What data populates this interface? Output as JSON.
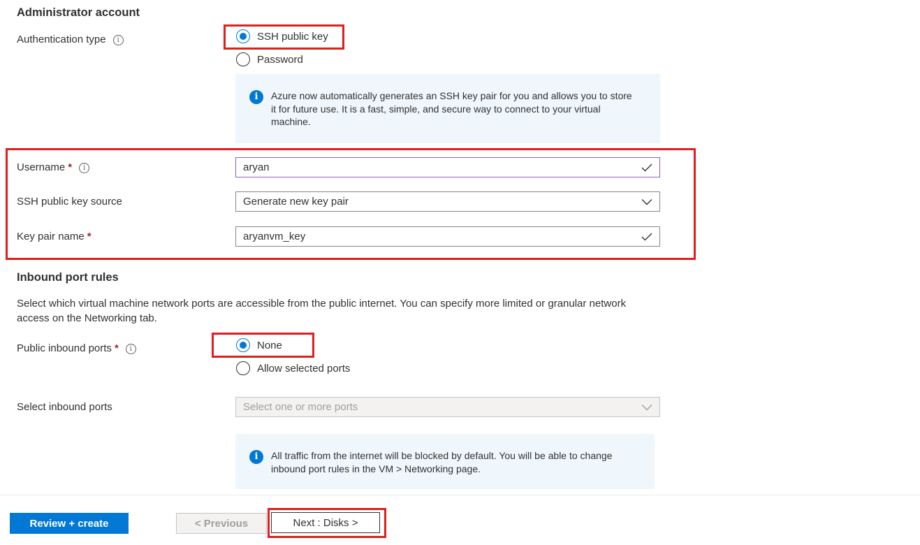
{
  "admin": {
    "heading": "Administrator account",
    "auth_label": "Authentication type",
    "auth_options": [
      "SSH public key",
      "Password"
    ],
    "auth_selected": "SSH public key",
    "ssh_info": "Azure now automatically generates an SSH key pair for you and allows you to store it for future use. It is a fast, simple, and secure way to connect to your virtual machine.",
    "username_label": "Username",
    "username_value": "aryan",
    "ssh_source_label": "SSH public key source",
    "ssh_source_value": "Generate new key pair",
    "keypair_label": "Key pair name",
    "keypair_value": "aryanvm_key",
    "required_mark": "*"
  },
  "inbound": {
    "heading": "Inbound port rules",
    "description": "Select which virtual machine network ports are accessible from the public internet. You can specify more limited or granular network access on the Networking tab.",
    "public_ports_label": "Public inbound ports",
    "port_options": [
      "None",
      "Allow selected ports"
    ],
    "port_selected": "None",
    "select_ports_label": "Select inbound ports",
    "select_ports_placeholder": "Select one or more ports",
    "traffic_info": "All traffic from the internet will be blocked by default. You will be able to change inbound port rules in the VM > Networking page."
  },
  "footer": {
    "review_create": "Review + create",
    "previous": "< Previous",
    "next": "Next : Disks >"
  },
  "icons": {
    "info_glyph": "i",
    "info": "info-icon",
    "check": "checkmark-icon",
    "chevron": "chevron-down-icon"
  },
  "colors": {
    "accent": "#0078d4",
    "highlight": "#e01e1e",
    "required": "#a4262c",
    "info_background": "#eff6fc"
  }
}
